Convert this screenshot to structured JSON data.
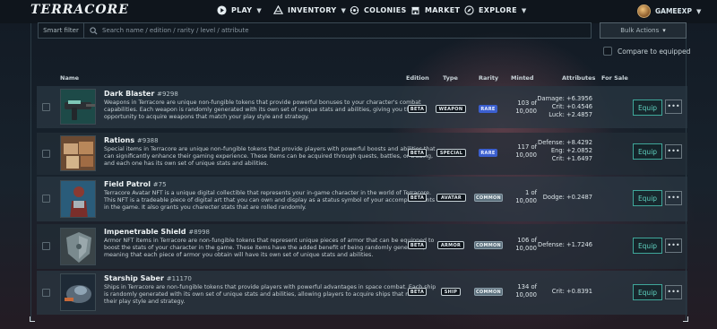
{
  "nav": {
    "logo": "TERRACORE",
    "items": [
      {
        "label": "PLAY",
        "icon": "play-icon",
        "caret": true
      },
      {
        "label": "INVENTORY",
        "icon": "inventory-icon",
        "caret": true
      },
      {
        "label": "COLONIES",
        "icon": "colonies-icon",
        "caret": false
      },
      {
        "label": "MARKET",
        "icon": "market-icon",
        "caret": false
      },
      {
        "label": "EXPLORE",
        "icon": "explore-icon",
        "caret": true
      }
    ],
    "username": "GAMEEXP"
  },
  "filters": {
    "smart_filter": "Smart filter",
    "search_placeholder": "Search name / edition / rarity / level / attribute",
    "bulk_actions": "Bulk Actions",
    "compare_label": "Compare to equipped"
  },
  "table": {
    "headers": {
      "name": "Name",
      "edition": "Edition",
      "type": "Type",
      "rarity": "Rarity",
      "minted": "Minted",
      "attributes": "Attributes",
      "for_sale": "For Sale"
    },
    "equip_label": "Equip",
    "more_label": "•••",
    "rows": [
      {
        "name": "Dark Blaster",
        "number": "#9298",
        "description": "Weapons in Terracore are unique non-fungible tokens that provide powerful bonuses to your character's combat capabilities. Each weapon is randomly generated with its own set of unique stats and abilities, giving you the opportunity to acquire weapons that match your play style and strategy.",
        "edition": "BETA",
        "type": "WEAPON",
        "rarity": "RARE",
        "minted": "103 of",
        "total": "10,000",
        "attributes": [
          "Damage: +6.3956",
          "Crit: +0.4546",
          "Luck: +2.4857"
        ]
      },
      {
        "name": "Rations",
        "number": "#9388",
        "description": "Special items in Terracore are unique non-fungible tokens that provide players with powerful boosts and abilities that can significantly enhance their gaming experience. These items can be acquired through quests, battles, or trading, and each one has its own set of unique stats and abilities.",
        "edition": "BETA",
        "type": "SPECIAL",
        "rarity": "RARE",
        "minted": "117 of",
        "total": "10,000",
        "attributes": [
          "Defense: +8.4292",
          "Eng: +2.0852",
          "Crit: +1.6497"
        ]
      },
      {
        "name": "Field Patrol",
        "number": "#75",
        "description": "Terracore Avatar NFT is a unique digital collectible that represents your in-game character in the world of Terracore. This NFT is a tradeable piece of digital art that you can own and display as a status symbol of your accomplishments in the game. It also grants you charecter stats that are rolled randomly.",
        "edition": "BETA",
        "type": "AVATAR",
        "rarity": "COMMON",
        "minted": "1 of",
        "total": "10,000",
        "attributes": [
          "Dodge: +0.2487"
        ]
      },
      {
        "name": "Impenetrable Shield",
        "number": "#8998",
        "description": "Armor NFT items in Terracore are non-fungible tokens that represent unique pieces of armor that can be equipped to boost the stats of your character in the game. These items have the added benefit of being randomly generated, meaning that each piece of armor you obtain will have its own set of unique stats and abilities.",
        "edition": "BETA",
        "type": "ARMOR",
        "rarity": "COMMON",
        "minted": "106 of",
        "total": "10,000",
        "attributes": [
          "Defense: +1.7246"
        ]
      },
      {
        "name": "Starship Saber",
        "number": "#11170",
        "description": "Ships in Terracore are non-fungible tokens that provide players with powerful advantages in space combat. Each ship is randomly generated with its own set of unique stats and abilities, allowing players to acquire ships that match their play style and strategy.",
        "edition": "BETA",
        "type": "SHIP",
        "rarity": "COMMON",
        "minted": "134 of",
        "total": "10,000",
        "attributes": [
          "Crit: +0.8391"
        ]
      }
    ]
  }
}
